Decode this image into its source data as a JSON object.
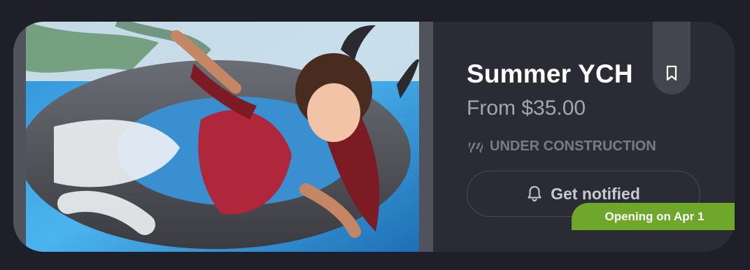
{
  "listing": {
    "title": "Summer YCH",
    "price": "From $35.00",
    "status": "UNDER CONSTRUCTION",
    "notify_label": "Get notified",
    "opening_badge": "Opening on Apr 1"
  },
  "icons": {
    "status": "construction-barrier-icon",
    "notify": "bell-icon",
    "save": "bookmark-icon"
  },
  "colors": {
    "page_bg": "#1f1f2a",
    "card_bg": "#2b2b35",
    "badge_green": "#6fa72b",
    "title": "#ffffff",
    "price": "#a5a6ad",
    "status": "#7a7b84"
  }
}
